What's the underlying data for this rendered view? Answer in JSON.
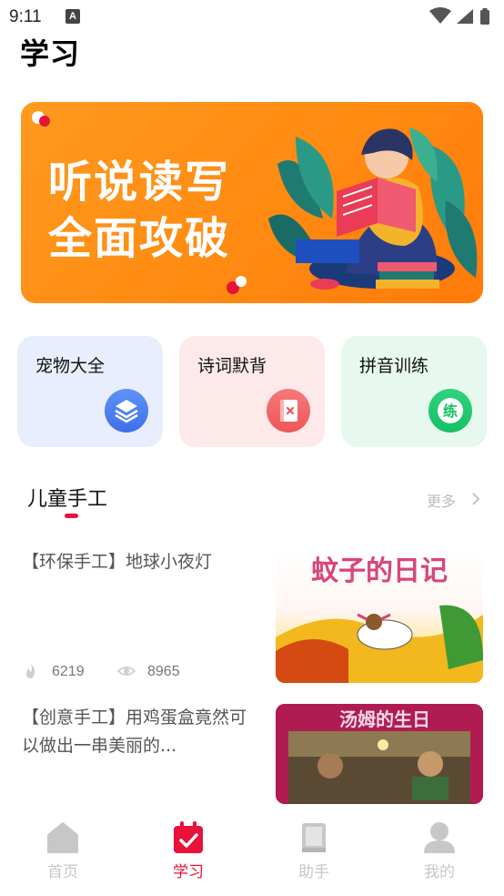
{
  "status_bar": {
    "time": "9:11",
    "notification_glyph": "A"
  },
  "header": {
    "title": "学习"
  },
  "banner": {
    "line1": "听说读写",
    "line2": "全面攻破"
  },
  "categories": [
    {
      "label": "宠物大全",
      "icon": "layers-icon",
      "color": "#4a7df0"
    },
    {
      "label": "诗词默背",
      "icon": "book-x-icon",
      "color": "#f06366"
    },
    {
      "label": "拼音训练",
      "icon": "practice-icon",
      "icon_text": "练",
      "color": "#1ec76b"
    }
  ],
  "section": {
    "title": "儿童手工",
    "more": "更多"
  },
  "articles": [
    {
      "title": "【环保手工】地球小夜灯",
      "likes": "6219",
      "views": "8965",
      "thumb_title": "蚊子的日记"
    },
    {
      "title": "【创意手工】用鸡蛋盒竟然可以做出一串美丽的...",
      "thumb_title": "汤姆的生日"
    }
  ],
  "tabs": [
    {
      "label": "首页",
      "icon": "home-icon",
      "active": false
    },
    {
      "label": "学习",
      "icon": "calendar-check-icon",
      "active": true
    },
    {
      "label": "助手",
      "icon": "book-icon",
      "active": false
    },
    {
      "label": "我的",
      "icon": "user-icon",
      "active": false
    }
  ],
  "colors": {
    "accent": "#e8123a",
    "banner": "#ff8a12",
    "inactive_tab": "#c7c7c7"
  }
}
